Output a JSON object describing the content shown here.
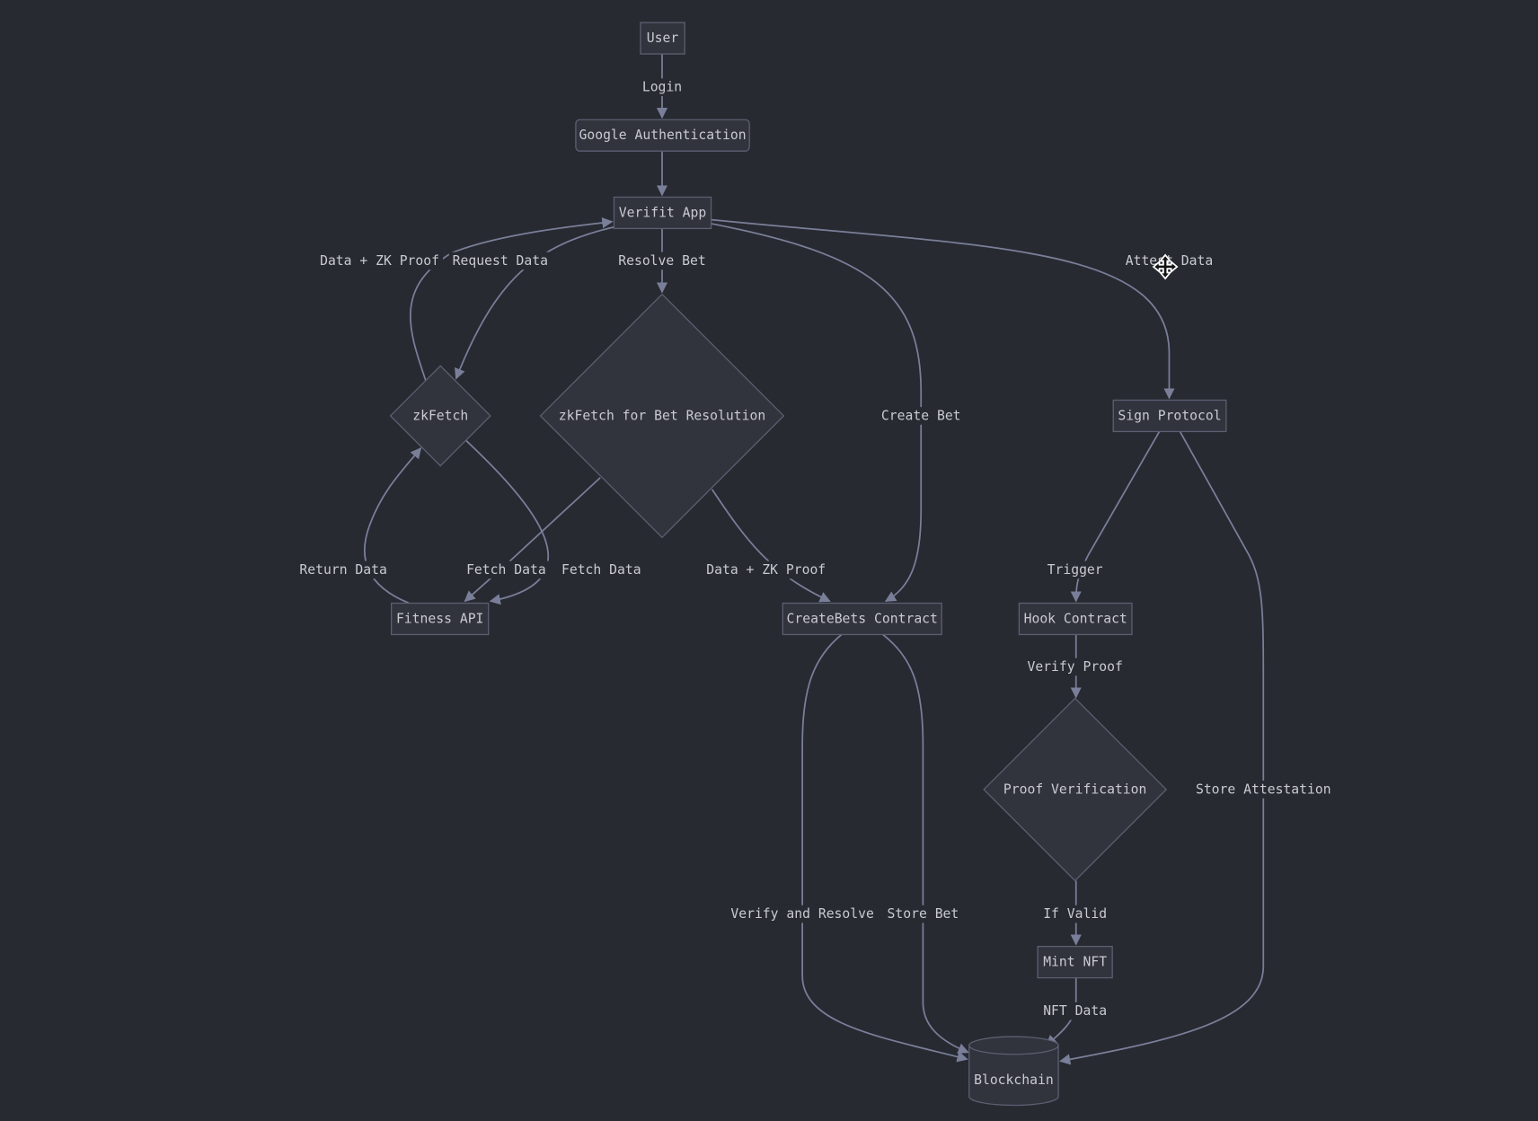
{
  "colors": {
    "background": "#272a31",
    "node_fill": "#31333d",
    "node_stroke": "#5b5f70",
    "edge": "#7a7f99",
    "text": "#c9cad2"
  },
  "nodes": {
    "user": {
      "label": "User",
      "shape": "rect"
    },
    "google": {
      "label": "Google Authentication",
      "shape": "rounded-rect"
    },
    "verifit": {
      "label": "Verifit App",
      "shape": "rect"
    },
    "zkfetch": {
      "label": "zkFetch",
      "shape": "diamond"
    },
    "resolve": {
      "label": "zkFetch for Bet Resolution",
      "shape": "diamond"
    },
    "sign": {
      "label": "Sign Protocol",
      "shape": "rect"
    },
    "fitness": {
      "label": "Fitness API",
      "shape": "rect"
    },
    "createbets": {
      "label": "CreateBets Contract",
      "shape": "rect"
    },
    "hook": {
      "label": "Hook Contract",
      "shape": "rect"
    },
    "proof": {
      "label": "Proof Verification",
      "shape": "diamond"
    },
    "mint": {
      "label": "Mint NFT",
      "shape": "rect"
    },
    "blockchain": {
      "label": "Blockchain",
      "shape": "cylinder"
    }
  },
  "edges": {
    "user_google": {
      "from": "user",
      "to": "google",
      "label": "Login"
    },
    "google_verifit": {
      "from": "google",
      "to": "verifit",
      "label": ""
    },
    "verifit_zkfetch": {
      "from": "verifit",
      "to": "zkfetch",
      "label": "Request Data"
    },
    "zkfetch_verifit": {
      "from": "zkfetch",
      "to": "verifit",
      "label": "Data + ZK Proof"
    },
    "verifit_resolve": {
      "from": "verifit",
      "to": "resolve",
      "label": "Resolve Bet"
    },
    "verifit_createbets": {
      "from": "verifit",
      "to": "createbets",
      "label": "Create Bet"
    },
    "verifit_sign": {
      "from": "verifit",
      "to": "sign",
      "label": "Attest Data"
    },
    "zkfetch_fitness": {
      "from": "zkfetch",
      "to": "fitness",
      "label": "Fetch Data"
    },
    "fitness_zkfetch": {
      "from": "fitness",
      "to": "zkfetch",
      "label": "Return Data"
    },
    "resolve_fitness": {
      "from": "resolve",
      "to": "fitness",
      "label": "Fetch Data"
    },
    "resolve_createbets": {
      "from": "resolve",
      "to": "createbets",
      "label": "Data + ZK Proof"
    },
    "sign_hook": {
      "from": "sign",
      "to": "hook",
      "label": "Trigger"
    },
    "sign_blockchain": {
      "from": "sign",
      "to": "blockchain",
      "label": "Store Attestation"
    },
    "hook_proof": {
      "from": "hook",
      "to": "proof",
      "label": "Verify Proof"
    },
    "proof_mint": {
      "from": "proof",
      "to": "mint",
      "label": "If Valid"
    },
    "mint_blockchain": {
      "from": "mint",
      "to": "blockchain",
      "label": "NFT Data"
    },
    "createbets_blockchain_verify": {
      "from": "createbets",
      "to": "blockchain",
      "label": "Verify and Resolve"
    },
    "createbets_blockchain_store": {
      "from": "createbets",
      "to": "blockchain",
      "label": "Store Bet"
    }
  },
  "cursor": {
    "icon": "move-cursor-icon"
  }
}
